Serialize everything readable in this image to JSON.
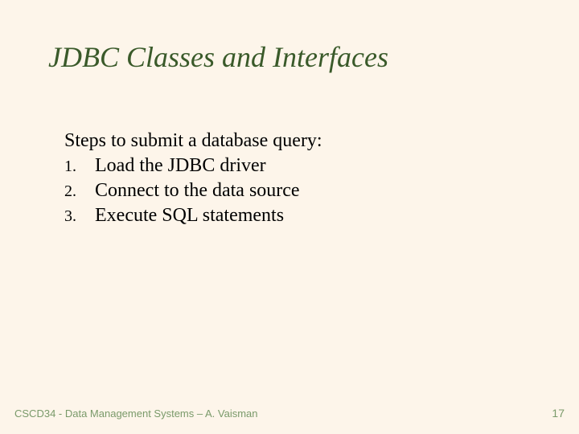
{
  "slide": {
    "title": "JDBC Classes and Interfaces",
    "intro": "Steps to submit a database query:",
    "steps": [
      {
        "number": "1.",
        "text": "Load the JDBC driver"
      },
      {
        "number": "2.",
        "text": "Connect to the data source"
      },
      {
        "number": "3.",
        "text": "Execute SQL statements"
      }
    ]
  },
  "footer": {
    "text": "CSCD34 - Data Management Systems – A. Vaisman",
    "page": "17"
  },
  "colors": {
    "background": "#fdf5ea",
    "title": "#3a5a2a",
    "body": "#000000",
    "footer": "#7a9a6a"
  }
}
